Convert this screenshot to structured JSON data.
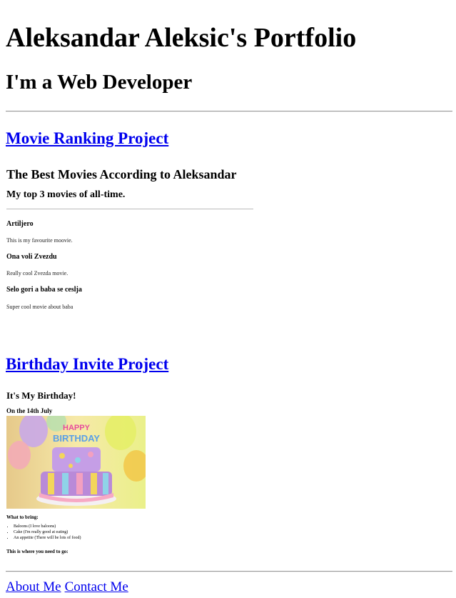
{
  "header": {
    "title": "Aleksandar Aleksic's Portfolio",
    "subtitle": "I'm a Web Developer"
  },
  "projects": [
    {
      "link_label": "Movie Ranking Project",
      "content": {
        "title": "The Best Movies According to Aleksandar",
        "subtitle": "My top 3 movies of all-time.",
        "movies": [
          {
            "name": "Artiljero",
            "description": "This is my favourite moovie."
          },
          {
            "name": "Ona voli Zvezdu",
            "description": "Really cool Zvezda movie."
          },
          {
            "name": "Selo gori a baba se ceslja",
            "description": "Super cool movie about baba"
          }
        ]
      }
    },
    {
      "link_label": "Birthday Invite Project",
      "content": {
        "title": "It's My Birthday!",
        "date": "On the 14th July",
        "image_text": "HAPPY BIRTHDAY",
        "bring_heading": "What to bring:",
        "bring_items": [
          "Baloons (I love baloons)",
          "Cake (I'm really good at eating)",
          "An appetite (There will be lots of food)"
        ],
        "where_heading": "This is where you need to go:"
      }
    }
  ],
  "footer": {
    "links": [
      "About Me",
      "Contact Me"
    ]
  },
  "colors": {
    "link": "#0000ee",
    "rule": "#9a9a9a",
    "text": "#000000"
  }
}
